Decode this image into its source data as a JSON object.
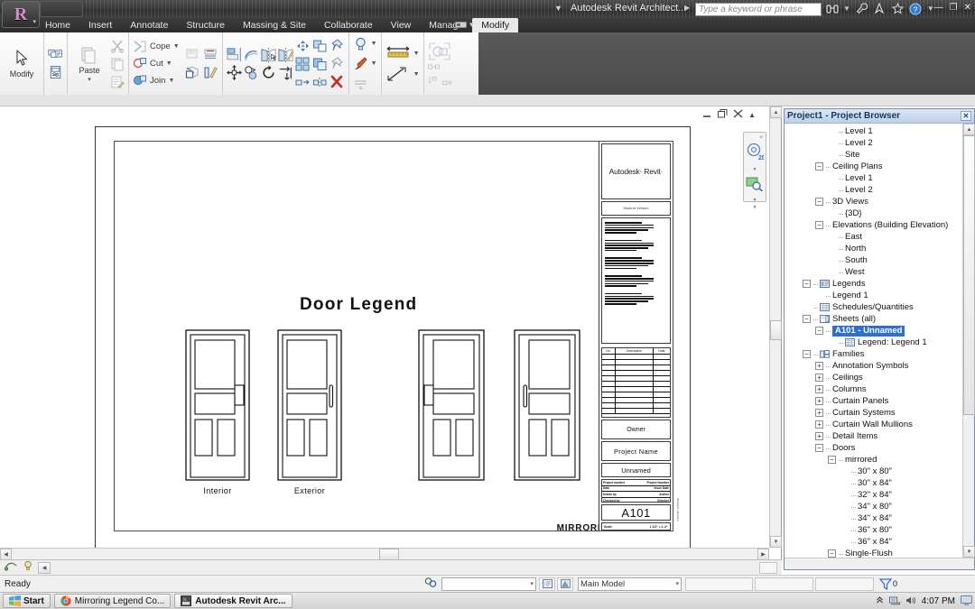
{
  "window": {
    "app_title": "Autodesk Revit Architect...",
    "search_placeholder": "Type a keyword or phrase",
    "minimize": "—",
    "maximize": "❐",
    "close": "✕",
    "help_icon": "help-icon",
    "binoculars_icon": "search-binoculars-icon",
    "wrench_icon": "wrench-icon",
    "signin_icon": "sign-in-icon",
    "star_icon": "favorites-star-icon",
    "orb_glyph": "R",
    "orb_caret": "▾"
  },
  "ribbon": {
    "tabs": [
      {
        "label": "Home",
        "active": false
      },
      {
        "label": "Insert",
        "active": false
      },
      {
        "label": "Annotate",
        "active": false
      },
      {
        "label": "Structure",
        "active": false
      },
      {
        "label": "Massing & Site",
        "active": false
      },
      {
        "label": "Collaborate",
        "active": false
      },
      {
        "label": "View",
        "active": false
      },
      {
        "label": "Manage",
        "active": false
      },
      {
        "label": "Modify",
        "active": true
      }
    ],
    "tab_overflow_icon": "panel-display-icon",
    "tab_overflow_caret": "▾",
    "select_panel": {
      "modify_label": "Modify",
      "modify_icon": "arrow-cursor-icon"
    },
    "properties_panel": {
      "properties_icon": "properties-palette-icon",
      "type_properties_icon": "type-properties-icon"
    },
    "clipboard_panel": {
      "paste_label": "Paste",
      "paste_caret": "▾",
      "cut_icon": "cut-scissors-icon",
      "copy_icon": "copy-icon",
      "match_icon": "match-type-icon"
    },
    "geometry_panel": {
      "cope_label": "Cope",
      "cut_label": "Cut",
      "join_label": "Join",
      "caret": "▾",
      "cope_icon": "cope-icon",
      "cut_icon": "cut-geometry-icon",
      "join_icon": "join-geometry-icon",
      "paint_icon": "paint-icon",
      "demolish_icon": "demolish-icon",
      "split_face_icon": "split-face-icon"
    },
    "modify_panel": {
      "align_icon": "align-icon",
      "offset_icon": "offset-icon",
      "mirror_pick_icon": "mirror-pick-axis-icon",
      "mirror_draw_icon": "mirror-draw-axis-icon",
      "move_icon": "move-icon",
      "copy_icon": "copy-move-icon",
      "rotate_icon": "rotate-icon",
      "trim_icon": "trim-extend-icon",
      "array_icon": "array-icon",
      "scale_icon": "scale-icon",
      "pin_icon": "pin-icon",
      "unpin_icon": "unpin-icon",
      "split_icon": "split-element-icon",
      "split_gap_icon": "split-with-gap-icon",
      "delete_icon": "delete-icon"
    },
    "view_panel": {
      "light_icon": "visibility-lightbulb-icon",
      "brush_icon": "paint-brush-icon",
      "linework_icon": "linework-icon",
      "caret": "▾"
    },
    "measure_panel": {
      "measure_between_icon": "measure-between-references-icon",
      "measure_along_icon": "measure-along-element-icon",
      "caret": "▾"
    },
    "create_panel": {
      "create_group_icon": "create-group-icon",
      "create_similar_icon": "create-similar-icon",
      "create_part_icon": "create-part-icon",
      "create_assembly_icon": "create-assembly-icon"
    }
  },
  "canvas": {
    "minimize_view_icon": "view-minimize-icon",
    "restore_view_icon": "view-restore-icon",
    "close_view_icon": "view-close-icon",
    "collapse_icon": "▲",
    "navbar": {
      "close": "×",
      "steering_wheel_icon": "steering-wheel-2d-icon",
      "zoom_icon": "zoom-region-icon",
      "caret": "▾"
    }
  },
  "sheet": {
    "legend_title": "Door  Legend",
    "doors": [
      {
        "caption": "Interior",
        "handle": "latch",
        "mirrored": false
      },
      {
        "caption": "Exterior",
        "handle": "pull",
        "mirrored": false
      },
      {
        "caption": "",
        "handle": "latch",
        "mirrored": true
      },
      {
        "caption": "",
        "handle": "pull",
        "mirrored": true
      }
    ],
    "mirrored_caption": "MIRRORED",
    "titleblock": {
      "logo": "Autodesk· Revit·",
      "logo_sub": "Student Version",
      "revision_headers": [
        "No.",
        "Description",
        "Date"
      ],
      "revision_rows": 11,
      "owner": "Owner",
      "project_name": "Project Name",
      "project_value": "Unnamed",
      "meta": [
        {
          "label": "Project number",
          "value": "Project Number"
        },
        {
          "label": "Date",
          "value": "Issue Date"
        },
        {
          "label": "Drawn by",
          "value": "Author"
        },
        {
          "label": "Checked by",
          "value": "Checker"
        }
      ],
      "sheet_number": "A101",
      "scale_label": "Scale",
      "scale_value": "1 1/2\" = 1'-0\"",
      "side_note": "Student Version"
    }
  },
  "browser": {
    "title": "Project1 - Project Browser",
    "close": "✕",
    "tree": [
      {
        "label": "Level 1",
        "depth": 3,
        "toggle": "none",
        "icon": "view-icon"
      },
      {
        "label": "Level 2",
        "depth": 3,
        "toggle": "none",
        "icon": "view-icon"
      },
      {
        "label": "Site",
        "depth": 3,
        "toggle": "none",
        "icon": "view-icon"
      },
      {
        "label": "Ceiling Plans",
        "depth": 2,
        "toggle": "minus",
        "icon": "none"
      },
      {
        "label": "Level 1",
        "depth": 3,
        "toggle": "none",
        "icon": "view-icon"
      },
      {
        "label": "Level 2",
        "depth": 3,
        "toggle": "none",
        "icon": "view-icon"
      },
      {
        "label": "3D Views",
        "depth": 2,
        "toggle": "minus",
        "icon": "none"
      },
      {
        "label": "{3D}",
        "depth": 3,
        "toggle": "none",
        "icon": "view-icon"
      },
      {
        "label": "Elevations (Building Elevation)",
        "depth": 2,
        "toggle": "minus",
        "icon": "none"
      },
      {
        "label": "East",
        "depth": 3,
        "toggle": "none",
        "icon": "view-icon"
      },
      {
        "label": "North",
        "depth": 3,
        "toggle": "none",
        "icon": "view-icon"
      },
      {
        "label": "South",
        "depth": 3,
        "toggle": "none",
        "icon": "view-icon"
      },
      {
        "label": "West",
        "depth": 3,
        "toggle": "none",
        "icon": "view-icon"
      },
      {
        "label": "Legends",
        "depth": 1,
        "toggle": "minus",
        "icon": "legend-icon"
      },
      {
        "label": "Legend 1",
        "depth": 2,
        "toggle": "none",
        "icon": "none"
      },
      {
        "label": "Schedules/Quantities",
        "depth": 1,
        "toggle": "none",
        "icon": "schedule-icon"
      },
      {
        "label": "Sheets (all)",
        "depth": 1,
        "toggle": "minus",
        "icon": "sheet-icon"
      },
      {
        "label": "A101 - Unnamed",
        "depth": 2,
        "toggle": "minus",
        "icon": "none",
        "selected": true
      },
      {
        "label": "Legend: Legend 1",
        "depth": 3,
        "toggle": "none",
        "icon": "schedule-icon"
      },
      {
        "label": "Families",
        "depth": 1,
        "toggle": "minus",
        "icon": "family-icon"
      },
      {
        "label": "Annotation Symbols",
        "depth": 2,
        "toggle": "plus",
        "icon": "none"
      },
      {
        "label": "Ceilings",
        "depth": 2,
        "toggle": "plus",
        "icon": "none"
      },
      {
        "label": "Columns",
        "depth": 2,
        "toggle": "plus",
        "icon": "none"
      },
      {
        "label": "Curtain Panels",
        "depth": 2,
        "toggle": "plus",
        "icon": "none"
      },
      {
        "label": "Curtain Systems",
        "depth": 2,
        "toggle": "plus",
        "icon": "none"
      },
      {
        "label": "Curtain Wall Mullions",
        "depth": 2,
        "toggle": "plus",
        "icon": "none"
      },
      {
        "label": "Detail Items",
        "depth": 2,
        "toggle": "plus",
        "icon": "none"
      },
      {
        "label": "Doors",
        "depth": 2,
        "toggle": "minus",
        "icon": "none"
      },
      {
        "label": "mirrored",
        "depth": 3,
        "toggle": "minus",
        "icon": "none"
      },
      {
        "label": "30\" x 80\"",
        "depth": 4,
        "toggle": "none",
        "icon": "none"
      },
      {
        "label": "30\" x 84\"",
        "depth": 4,
        "toggle": "none",
        "icon": "none"
      },
      {
        "label": "32\" x 84\"",
        "depth": 4,
        "toggle": "none",
        "icon": "none"
      },
      {
        "label": "34\" x 80\"",
        "depth": 4,
        "toggle": "none",
        "icon": "none"
      },
      {
        "label": "34\" x 84\"",
        "depth": 4,
        "toggle": "none",
        "icon": "none"
      },
      {
        "label": "36\" x 80\"",
        "depth": 4,
        "toggle": "none",
        "icon": "none"
      },
      {
        "label": "36\" x 84\"",
        "depth": 4,
        "toggle": "none",
        "icon": "none"
      },
      {
        "label": "Single-Flush",
        "depth": 3,
        "toggle": "minus",
        "icon": "none"
      }
    ]
  },
  "viewcontrol": {
    "scale_icon": "view-scale-icon",
    "detail_icon": "detail-level-icon",
    "nav_icon": "navigate-icon"
  },
  "status": {
    "ready": "Ready",
    "filter_icon": "filter-icon",
    "selector_value": "",
    "selector_caret": "▾",
    "properties_icon": "properties-toggle-icon",
    "modelsite_icon": "model-site-icon",
    "worksets_label": "Main Model",
    "worksets_caret": "▾",
    "filter_count": "0",
    "filter_funnel_icon": "funnel-icon"
  },
  "taskbar": {
    "start_label": "Start",
    "start_icon": "windows-flag-icon",
    "tasks": [
      {
        "label": "Mirroring Legend Co...",
        "icon": "chrome-icon",
        "active": false
      },
      {
        "label": "Autodesk Revit Arc...",
        "icon": "revit-icon",
        "active": true
      }
    ],
    "tray": {
      "show_hidden_icon": "show-hidden-icons-icon",
      "network_icon": "network-icon",
      "volume_icon": "volume-icon",
      "time": "4:07 PM",
      "desktop_icon": "show-desktop-icon"
    }
  },
  "colors": {
    "accent": "#2f6fd0",
    "titlebar": "#3a3a3a",
    "browser_header": "#bcd0e8",
    "ribbon_bg": "#f1f1f1"
  }
}
